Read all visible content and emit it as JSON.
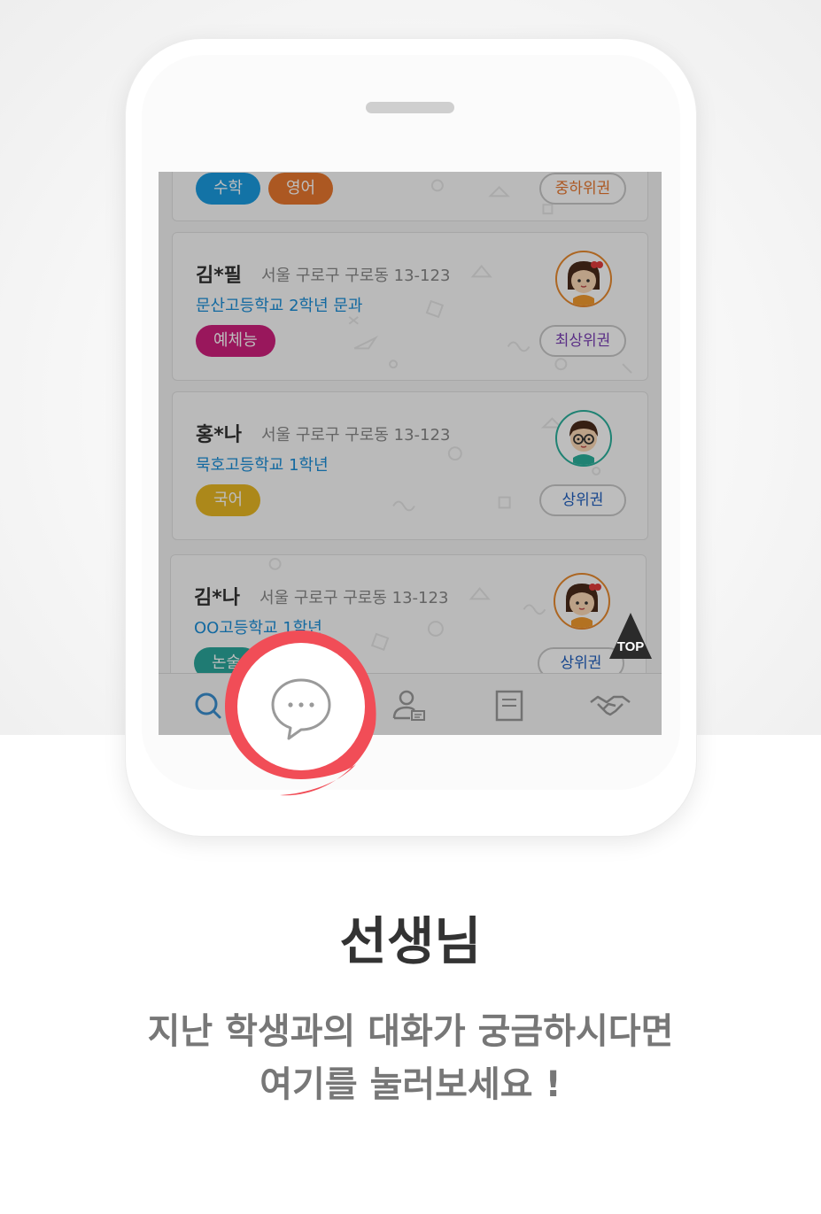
{
  "colors": {
    "accent_red": "#f14d57",
    "school_blue": "#1a8ed8",
    "subject_math": "#1a9be0",
    "subject_english": "#e8772e",
    "subject_art": "#cf1f7d",
    "subject_korean": "#e9b824",
    "subject_essay": "#2aa79b",
    "rank_mid_high": "#e8772e",
    "rank_top": "#7a3fb5",
    "rank_high": "#1f5fbf"
  },
  "cards": [
    {
      "name": "",
      "address": "",
      "school": "",
      "subjects": [
        {
          "label": "수학",
          "color": "#1a9be0"
        },
        {
          "label": "영어",
          "color": "#e8772e"
        }
      ],
      "rank": {
        "label": "중하위권",
        "color": "#e8772e"
      },
      "avatar": "none"
    },
    {
      "name": "김*필",
      "address": "서울 구로구 구로동 13-123",
      "school": "문산고등학교 2학년 문과",
      "subjects": [
        {
          "label": "예체능",
          "color": "#cf1f7d"
        }
      ],
      "rank": {
        "label": "최상위권",
        "color": "#7a3fb5"
      },
      "avatar": "girl-avatar-icon"
    },
    {
      "name": "홍*나",
      "address": "서울 구로구 구로동 13-123",
      "school": "묵호고등학교 1학년",
      "subjects": [
        {
          "label": "국어",
          "color": "#e9b824"
        }
      ],
      "rank": {
        "label": "상위권",
        "color": "#1f5fbf"
      },
      "avatar": "boy-glasses-avatar-icon"
    },
    {
      "name": "김*나",
      "address": "서울 구로구 구로동 13-123",
      "school": "OO고등학교 1학년",
      "subjects": [
        {
          "label": "논술",
          "color": "#2aa79b"
        }
      ],
      "rank": {
        "label": "상위권",
        "color": "#1f5fbf"
      },
      "avatar": "girl-avatar-icon"
    }
  ],
  "top_button": {
    "label": "TOP"
  },
  "tabbar": {
    "tabs": [
      {
        "icon": "search-icon",
        "active": true
      },
      {
        "icon": "chat-bubble-icon",
        "active": false
      },
      {
        "icon": "profile-card-icon",
        "active": false
      },
      {
        "icon": "document-icon",
        "active": false
      },
      {
        "icon": "handshake-icon",
        "active": false
      }
    ]
  },
  "headline": "선생님",
  "description": {
    "line1": "지난 학생과의 대화가 궁금하시다면",
    "line2": "여기를 눌러보세요 !"
  }
}
